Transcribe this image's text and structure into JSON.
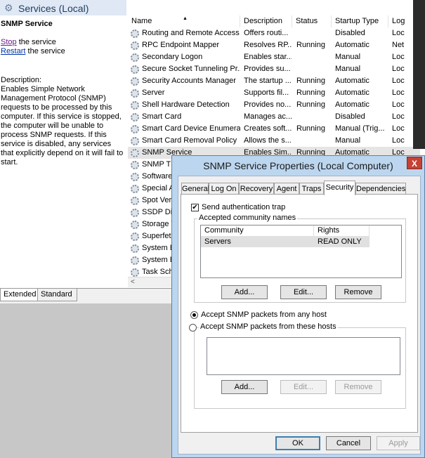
{
  "services_window": {
    "header_title": "Services (Local)",
    "selected_service_name": "SNMP Service",
    "stop_link": "Stop",
    "stop_suffix": " the service",
    "restart_link": "Restart",
    "restart_suffix": " the service",
    "description_label": "Description:",
    "description_text": "Enables Simple Network Management Protocol (SNMP) requests to be processed by this computer. If this service is stopped, the computer will be unable to process SNMP requests. If this service is disabled, any services that explicitly depend on it will fail to start.",
    "columns": {
      "name": "Name",
      "description": "Description",
      "status": "Status",
      "startup_type": "Startup Type",
      "log_on_as": "Log"
    },
    "rows": [
      {
        "name": "Routing and Remote Access",
        "description": "Offers routi...",
        "status": "",
        "startup": "Disabled",
        "logon": "Loc"
      },
      {
        "name": "RPC Endpoint Mapper",
        "description": "Resolves RP...",
        "status": "Running",
        "startup": "Automatic",
        "logon": "Net"
      },
      {
        "name": "Secondary Logon",
        "description": "Enables star...",
        "status": "",
        "startup": "Manual",
        "logon": "Loc"
      },
      {
        "name": "Secure Socket Tunneling Pr...",
        "description": "Provides su...",
        "status": "",
        "startup": "Manual",
        "logon": "Loc"
      },
      {
        "name": "Security Accounts Manager",
        "description": "The startup ...",
        "status": "Running",
        "startup": "Automatic",
        "logon": "Loc"
      },
      {
        "name": "Server",
        "description": "Supports fil...",
        "status": "Running",
        "startup": "Automatic",
        "logon": "Loc"
      },
      {
        "name": "Shell Hardware Detection",
        "description": "Provides no...",
        "status": "Running",
        "startup": "Automatic",
        "logon": "Loc"
      },
      {
        "name": "Smart Card",
        "description": "Manages ac...",
        "status": "",
        "startup": "Disabled",
        "logon": "Loc"
      },
      {
        "name": "Smart Card Device Enumera...",
        "description": "Creates soft...",
        "status": "Running",
        "startup": "Manual (Trig...",
        "logon": "Loc"
      },
      {
        "name": "Smart Card Removal Policy",
        "description": "Allows the s...",
        "status": "",
        "startup": "Manual",
        "logon": "Loc"
      },
      {
        "name": "SNMP Service",
        "description": "Enables Sim...",
        "status": "Running",
        "startup": "Automatic",
        "logon": "Loc"
      },
      {
        "name": "SNMP T",
        "description": "",
        "status": "",
        "startup": "",
        "logon": ""
      },
      {
        "name": "Software",
        "description": "",
        "status": "",
        "startup": "",
        "logon": ""
      },
      {
        "name": "Special A",
        "description": "",
        "status": "",
        "startup": "",
        "logon": ""
      },
      {
        "name": "Spot Ver",
        "description": "",
        "status": "",
        "startup": "",
        "logon": ""
      },
      {
        "name": "SSDP Dis",
        "description": "",
        "status": "",
        "startup": "",
        "logon": ""
      },
      {
        "name": "Storage T",
        "description": "",
        "status": "",
        "startup": "",
        "logon": ""
      },
      {
        "name": "Superfet",
        "description": "",
        "status": "",
        "startup": "",
        "logon": ""
      },
      {
        "name": "System E",
        "description": "",
        "status": "",
        "startup": "",
        "logon": ""
      },
      {
        "name": "System E",
        "description": "",
        "status": "",
        "startup": "",
        "logon": ""
      },
      {
        "name": "Task Sch",
        "description": "",
        "status": "",
        "startup": "",
        "logon": ""
      }
    ],
    "bottom_tabs": {
      "extended": "Extended",
      "standard": "Standard"
    }
  },
  "dialog": {
    "title": "SNMP Service Properties (Local Computer)",
    "close_glyph": "X",
    "tabs": [
      "General",
      "Log On",
      "Recovery",
      "Agent",
      "Traps",
      "Security",
      "Dependencies"
    ],
    "active_tab": "Security",
    "send_auth_trap_label": "Send authentication trap",
    "send_auth_trap_checked": true,
    "community_group_label": "Accepted community names",
    "community_columns": {
      "community": "Community",
      "rights": "Rights"
    },
    "communities": [
      {
        "community": "Servers",
        "rights": "READ ONLY"
      }
    ],
    "add_button": "Add...",
    "edit_button": "Edit...",
    "remove_button": "Remove",
    "radio_any_host": "Accept SNMP packets from any host",
    "radio_these_hosts": "Accept SNMP packets from these hosts",
    "selected_radio": "any_host",
    "hosts_add_button": "Add...",
    "hosts_edit_button": "Edit...",
    "hosts_remove_button": "Remove",
    "ok_button": "OK",
    "cancel_button": "Cancel",
    "apply_button": "Apply"
  }
}
